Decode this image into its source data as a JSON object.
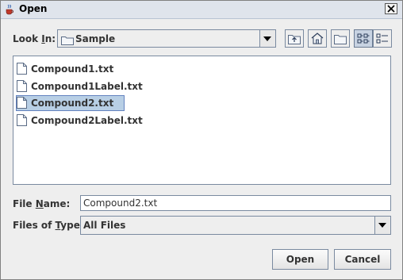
{
  "window": {
    "title": "Open"
  },
  "look_in": {
    "label_prefix": "Look ",
    "label_mnemonic": "I",
    "label_suffix": "n:",
    "value": "Sample"
  },
  "toolbar": {
    "icons": [
      "up-one-level-icon",
      "home-icon",
      "new-folder-icon",
      "list-view-icon",
      "details-view-icon"
    ],
    "active_view": "list"
  },
  "files": [
    {
      "name": "Compound1.txt",
      "selected": false
    },
    {
      "name": "Compound1Label.txt",
      "selected": false
    },
    {
      "name": "Compound2.txt",
      "selected": true
    },
    {
      "name": "Compound2Label.txt",
      "selected": false
    }
  ],
  "file_name": {
    "label_prefix": "File ",
    "label_mnemonic": "N",
    "label_suffix": "ame:",
    "value": "Compound2.txt"
  },
  "files_of_type": {
    "label_prefix": "Files of ",
    "label_mnemonic": "T",
    "label_suffix": "ype:",
    "value": "All Files"
  },
  "buttons": {
    "open": "Open",
    "cancel": "Cancel"
  },
  "colors": {
    "selection": "#b8cfe5",
    "titlebar": "#dfe4ec"
  }
}
